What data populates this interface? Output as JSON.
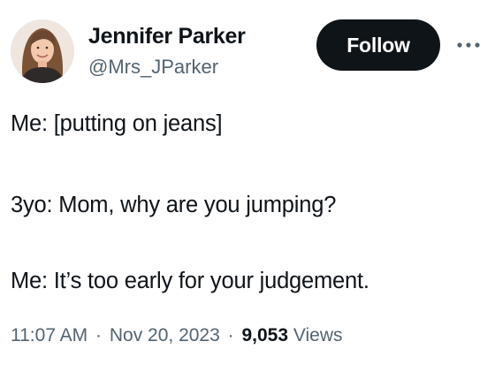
{
  "author": {
    "display_name": "Jennifer Parker",
    "handle": "@Mrs_JParker",
    "avatar_icon": "profile-photo"
  },
  "actions": {
    "follow_label": "Follow",
    "more_icon": "more-horizontal-icon"
  },
  "tweet": {
    "lines": [
      "Me: [putting on jeans]",
      "3yo: Mom, why are you jumping?",
      "Me: It’s too early for your judgement."
    ]
  },
  "meta": {
    "time": "11:07 AM",
    "separator": "·",
    "date": "Nov 20, 2023",
    "views_count": "9,053",
    "views_label": "Views"
  },
  "colors": {
    "text_primary": "#0f1419",
    "text_secondary": "#536471",
    "follow_bg": "#0f1419",
    "follow_text": "#ffffff"
  }
}
